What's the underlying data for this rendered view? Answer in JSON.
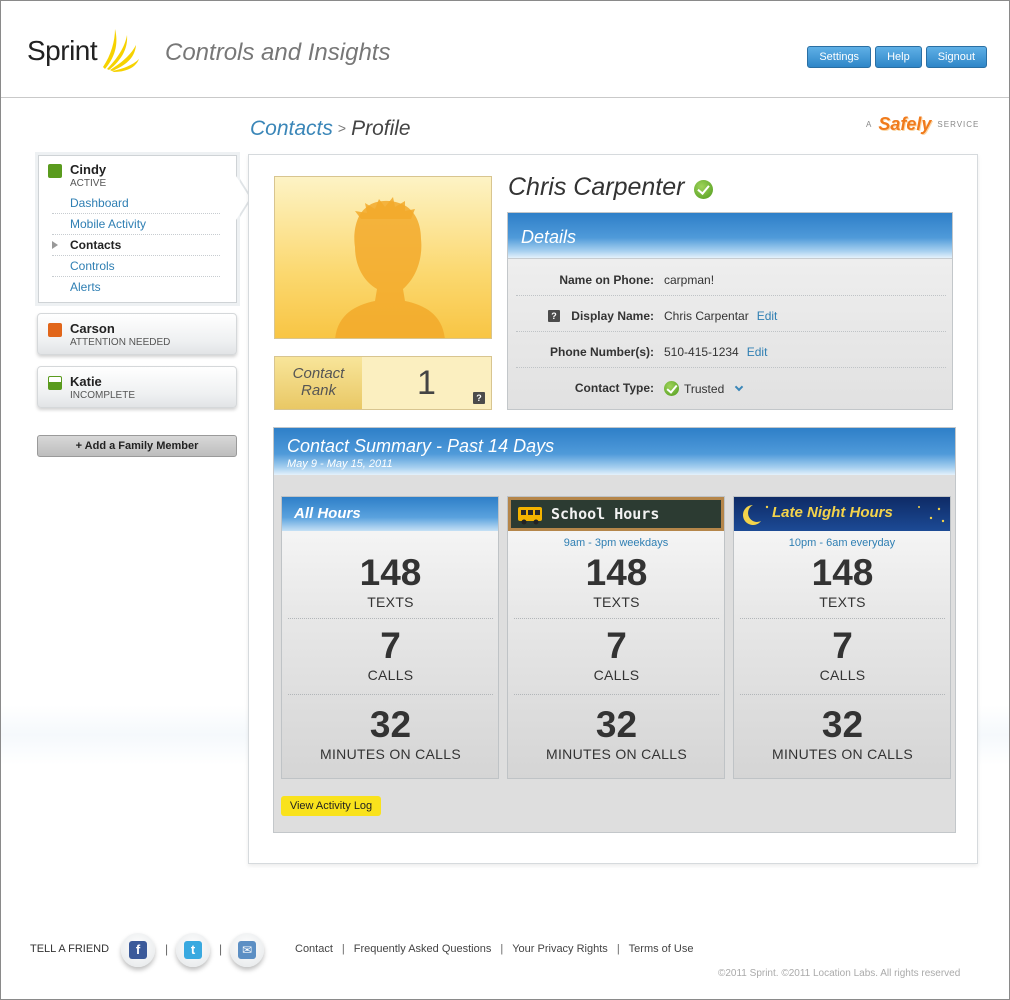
{
  "header": {
    "logo_text": "Sprint",
    "app_title": "Controls and Insights",
    "buttons": [
      "Settings",
      "Help",
      "Signout"
    ]
  },
  "breadcrumb": {
    "parent": "Contacts",
    "separator": ">",
    "current": "Profile"
  },
  "service_badge": {
    "prefix": "A",
    "name": "Safely",
    "suffix": "SERVICE"
  },
  "sidebar": {
    "members": [
      {
        "name": "Cindy",
        "status": "ACTIVE",
        "color": "#5a9b1e"
      },
      {
        "name": "Carson",
        "status": "ATTENTION NEEDED",
        "color": "#e1661a"
      },
      {
        "name": "Katie",
        "status": "INCOMPLETE",
        "color": "#5a9b1e"
      }
    ],
    "nav": [
      "Dashboard",
      "Mobile Activity",
      "Contacts",
      "Controls",
      "Alerts"
    ],
    "add_member": "+ Add a Family Member"
  },
  "contact": {
    "name": "Chris Carpenter",
    "rank_label_1": "Contact",
    "rank_label_2": "Rank",
    "rank_value": "1",
    "help_icon": "?"
  },
  "details": {
    "title": "Details",
    "rows": [
      {
        "label": "Name on Phone:",
        "value": "carpman!"
      },
      {
        "label": "Display Name:",
        "value": "Chris Carpentar",
        "action": "Edit"
      },
      {
        "label": "Phone Number(s):",
        "value": "510-415-1234",
        "action": "Edit"
      },
      {
        "label": "Contact Type:",
        "value": "Trusted"
      }
    ]
  },
  "summary": {
    "title": "Contact Summary - Past 14 Days",
    "dates": "May 9 - May 15, 2011",
    "columns": [
      {
        "title": "All Hours",
        "subtitle": "",
        "texts": "148",
        "calls": "7",
        "minutes": "32"
      },
      {
        "title": "School Hours",
        "subtitle": "9am - 3pm weekdays",
        "texts": "148",
        "calls": "7",
        "minutes": "32"
      },
      {
        "title": "Late Night Hours",
        "subtitle": "10pm - 6am everyday",
        "texts": "148",
        "calls": "7",
        "minutes": "32"
      }
    ],
    "labels": {
      "texts": "TEXTS",
      "calls": "CALLS",
      "minutes": "MINUTES ON CALLS"
    },
    "view_log": "View Activity Log"
  },
  "footer": {
    "tell_a_friend": "TELL A FRIEND",
    "social": [
      {
        "icon": "facebook-icon",
        "glyph": "f",
        "color": "#3b5a9a"
      },
      {
        "icon": "twitter-icon",
        "glyph": "t",
        "color": "#39a9e0"
      },
      {
        "icon": "email-icon",
        "glyph": "✉",
        "color": "#5c8fc4"
      }
    ],
    "social_sep": "|",
    "links": [
      "Contact",
      "Frequently Asked Questions",
      "Your Privacy Rights",
      "Terms of Use"
    ],
    "link_sep": "|",
    "copyright": "©2011 Sprint. ©2011 Location Labs. All rights reserved"
  }
}
